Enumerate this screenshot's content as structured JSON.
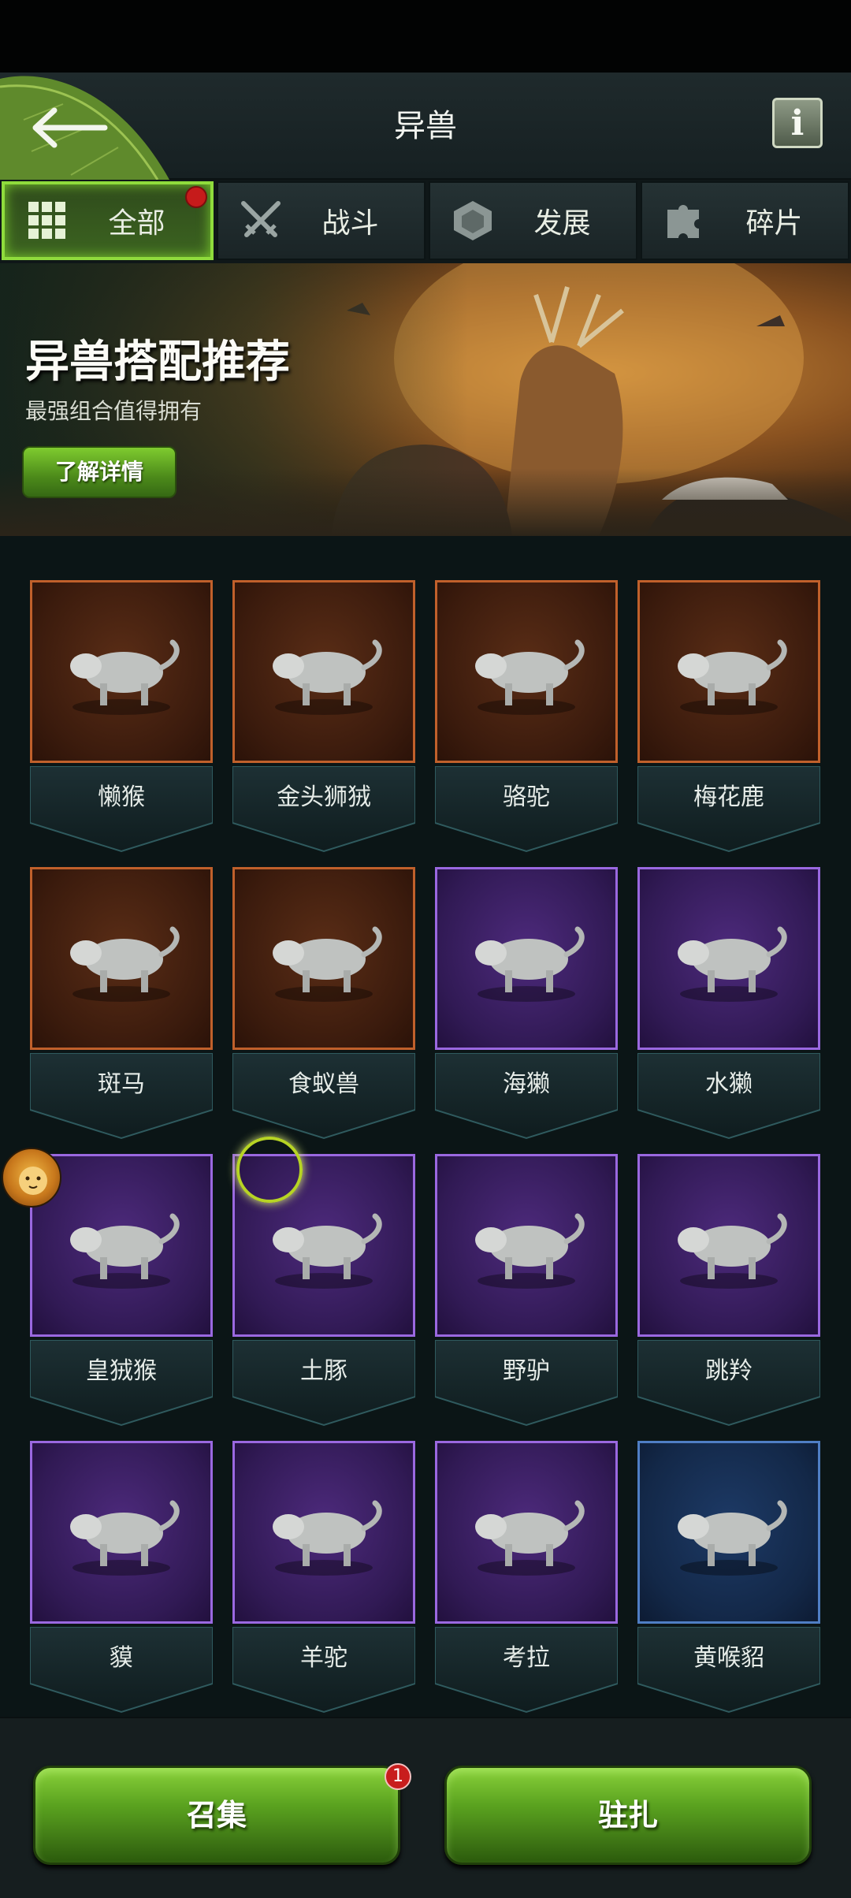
{
  "header": {
    "title": "异兽",
    "info_label": "i"
  },
  "tabs": [
    {
      "label": "全部",
      "icon": "grid-icon",
      "active": true,
      "has_dot": true
    },
    {
      "label": "战斗",
      "icon": "crossed-swords-icon",
      "active": false
    },
    {
      "label": "发展",
      "icon": "hexagon-gem-icon",
      "active": false
    },
    {
      "label": "碎片",
      "icon": "puzzle-piece-icon",
      "active": false
    }
  ],
  "banner": {
    "title": "异兽搭配推荐",
    "subtitle": "最强组合值得拥有",
    "button_label": "了解详情"
  },
  "beasts": [
    {
      "name": "懒猴",
      "rarity": "orange"
    },
    {
      "name": "金头狮狨",
      "rarity": "orange"
    },
    {
      "name": "骆驼",
      "rarity": "orange"
    },
    {
      "name": "梅花鹿",
      "rarity": "orange"
    },
    {
      "name": "斑马",
      "rarity": "orange"
    },
    {
      "name": "食蚁兽",
      "rarity": "orange"
    },
    {
      "name": "海獭",
      "rarity": "purple"
    },
    {
      "name": "水獭",
      "rarity": "purple"
    },
    {
      "name": "皇狨猴",
      "rarity": "purple"
    },
    {
      "name": "土豚",
      "rarity": "purple"
    },
    {
      "name": "野驴",
      "rarity": "purple"
    },
    {
      "name": "跳羚",
      "rarity": "purple"
    },
    {
      "name": "貘",
      "rarity": "purple"
    },
    {
      "name": "羊驼",
      "rarity": "purple"
    },
    {
      "name": "考拉",
      "rarity": "purple"
    },
    {
      "name": "黄喉貂",
      "rarity": "blue"
    }
  ],
  "buttons": {
    "gather_label": "召集",
    "gather_badge": "1",
    "station_label": "驻扎"
  },
  "colors": {
    "accent_green": "#8fdc3c",
    "orange_frame": "#c0602b",
    "purple_frame": "#9a68e0",
    "blue_frame": "#4f7ec4",
    "badge_red": "#c61b1b"
  }
}
